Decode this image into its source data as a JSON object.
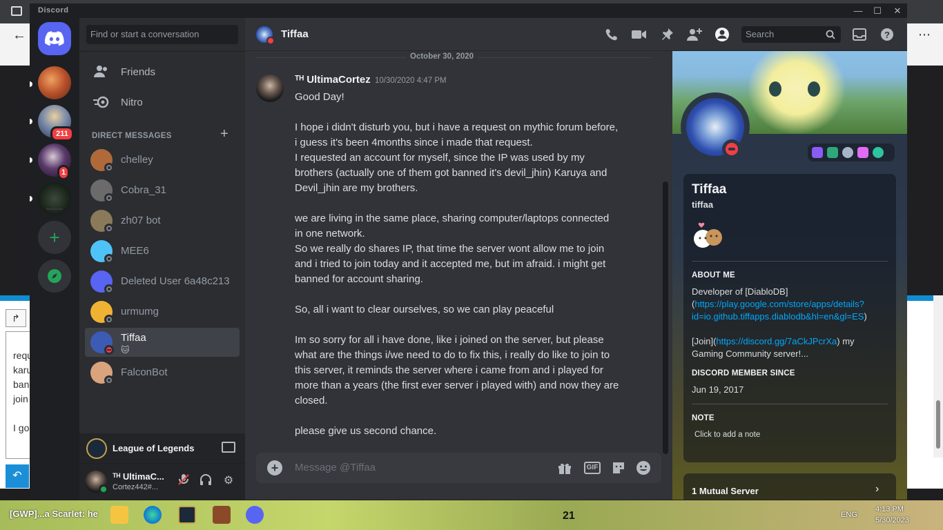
{
  "window": {
    "app_title": "Discord",
    "minimize": "—",
    "maximize": "☐",
    "close": "✕"
  },
  "servers": {
    "badge_1": "211",
    "badge_2": "1"
  },
  "sidebar": {
    "search_placeholder": "Find or start a conversation",
    "friends": "Friends",
    "nitro": "Nitro",
    "dm_header": "DIRECT MESSAGES",
    "dm_add": "+",
    "dms": [
      {
        "name": "chelley",
        "status": "offline",
        "color": "#b06a3a"
      },
      {
        "name": "Cobra_31",
        "status": "offline",
        "color": "#6b6b6b"
      },
      {
        "name": "zh07 bot",
        "status": "offline",
        "color": "#8a7a5a"
      },
      {
        "name": "MEE6",
        "status": "offline",
        "color": "#4fc3f7"
      },
      {
        "name": "Deleted User 6a48c213",
        "status": "offline",
        "color": "#5865f2"
      },
      {
        "name": "urmumg",
        "status": "offline",
        "color": "#f0b232"
      },
      {
        "name": "Tiffaa",
        "status": "dnd",
        "color": "#3b5bb5",
        "sub": "🐱"
      },
      {
        "name": "FalconBot",
        "status": "offline",
        "color": "#d9a37c"
      }
    ],
    "game": "League of Legends",
    "user_name": "ᵀᴴ UltimaC...",
    "user_tag": "Cortez442#..."
  },
  "chat": {
    "title": "Tiffaa",
    "search_placeholder": "Search",
    "date": "October 30, 2020",
    "author": "ᵀᴴ UltimaCortez",
    "timestamp": "10/30/2020 4:47 PM",
    "lines": [
      "Good Day!",
      "",
      "I hope i didn't disturb you, but i have a request on mythic forum before,",
      "i guess it's been 4months since i made that request.",
      "I requested an account for myself, since the IP was used by my",
      "brothers (actually one of them got banned it's devil_jhin) Karuya and",
      "Devil_jhin are my brothers.",
      "",
      "we are living in the same place, sharing computer/laptops connected",
      "in one network.",
      "So we really do shares IP, that time the server wont allow me to join",
      "and i tried to join today and it accepted me, but im afraid. i might get",
      "banned for account sharing.",
      "",
      "So, all i want to clear ourselves, so we can play peaceful",
      "",
      "Im so sorry for all i have done, like i joined on the server, but please",
      "what are the things i/we need to do to fix this, i really do like to join to",
      "this server, it reminds the server where i came from and i played for",
      "more than a years (the first ever server i played with) and now they are",
      "closed.",
      "",
      "please give us second chance."
    ],
    "composer_placeholder": "Message @Tiffaa",
    "gif": "GIF"
  },
  "profile": {
    "display_name": "Tiffaa",
    "username": "tiffaa",
    "about_header": "ABOUT ME",
    "about_line1": "Developer of [DiabloDB]",
    "about_line2_prefix": "(",
    "about_link1": "https://play.google.com/store/apps/details?",
    "about_link1b": "id=io.github.tiffapps.diablodb&hl=en&gl=ES",
    "about_line3_suffix": ")",
    "about_join_prefix": "[Join](",
    "about_link2": "https://discord.gg/7aCkJPcrXa",
    "about_join_suffix": ") my",
    "about_line5": "Gaming Community server!...",
    "member_since_header": "DISCORD MEMBER SINCE",
    "member_since": "Jun 19, 2017",
    "note_header": "NOTE",
    "note_placeholder": "Click to add a note",
    "mutual": "1 Mutual Server"
  },
  "taskbar": {
    "text": "[GWP]...a Scarlet: he",
    "number": "21",
    "lang": "ENG",
    "time": "4:13 PM",
    "date": "5/30/2023"
  },
  "colors": {
    "accent": "#5865f2",
    "dnd": "#f23f43",
    "online": "#23a559",
    "link": "#00a8fc"
  }
}
